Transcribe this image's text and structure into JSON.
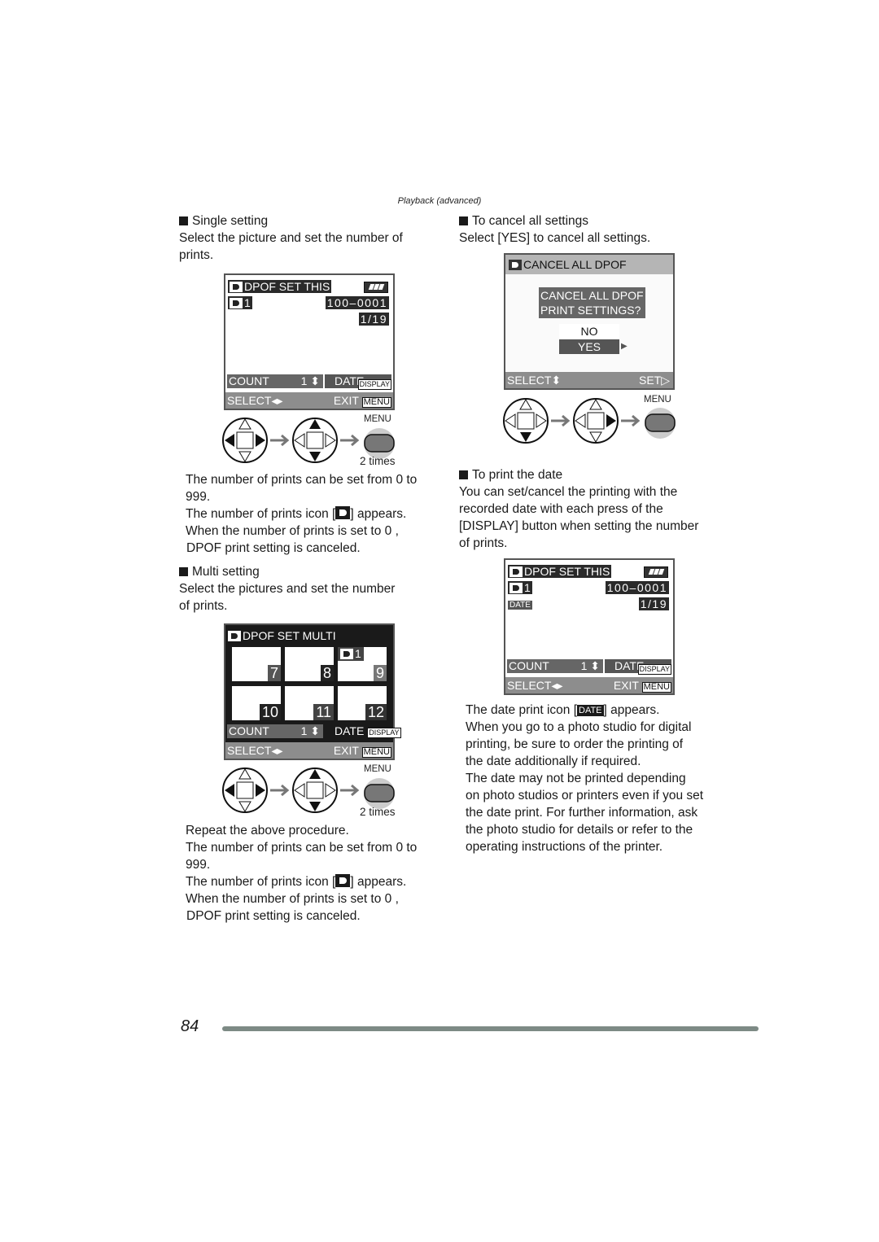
{
  "header": {
    "section": "Playback (advanced)"
  },
  "left": {
    "single": {
      "heading": "Single setting",
      "desc_lines": [
        "Select the picture and set the number of",
        "prints."
      ],
      "screen": {
        "title": "DPOF SET THIS",
        "print_count": "1",
        "file_number": "100–0001",
        "frame": "1/19",
        "count_label": "COUNT",
        "count_value": "1",
        "date_label": "DATE",
        "display_label": "DISPLAY",
        "select_label": "SELECT",
        "exit_label": "EXIT",
        "menu_label": "MENU"
      },
      "steps": {
        "menu_label": "MENU",
        "times_label": "2 times"
      },
      "notes": [
        "The number of prints can be set from 0 to",
        "999.",
        "The number of prints icon [",
        "] appears.",
        "When the number of prints is set to  0 ,",
        "DPOF print setting is canceled."
      ]
    },
    "multi": {
      "heading": "Multi setting",
      "desc_lines": [
        "Select the pictures and set the number",
        "of prints."
      ],
      "screen": {
        "title": "DPOF SET MULTI",
        "thumbs": [
          "7",
          "8",
          "9",
          "10",
          "11",
          "12"
        ],
        "marked_thumb_count": "1",
        "count_label": "COUNT",
        "count_value": "1",
        "date_label": "DATE",
        "display_label": "DISPLAY",
        "select_label": "SELECT",
        "exit_label": "EXIT",
        "menu_label": "MENU"
      },
      "steps": {
        "menu_label": "MENU",
        "times_label": "2 times"
      },
      "notes": [
        "Repeat the above procedure.",
        "The number of prints can be set from 0 to",
        "999.",
        "The number of prints icon [",
        "] appears.",
        "When the number of prints is set to  0 ,",
        "DPOF print setting is canceled."
      ]
    }
  },
  "right": {
    "cancel": {
      "heading": "To cancel all settings",
      "desc": "Select [YES] to cancel all settings.",
      "screen": {
        "title": "CANCEL ALL DPOF",
        "question_line1": "CANCEL ALL DPOF",
        "question_line2": "PRINT SETTINGS?",
        "option_no": "NO",
        "option_yes": "YES",
        "select_label": "SELECT",
        "set_label": "SET"
      },
      "steps": {
        "menu_label": "MENU"
      }
    },
    "date": {
      "heading": "To print the date",
      "desc_lines": [
        "You can set/cancel the printing with the",
        "recorded date with each press of the",
        "[DISPLAY] button when setting the number",
        "of prints."
      ],
      "screen": {
        "title": "DPOF SET THIS",
        "print_count": "1",
        "date_badge": "DATE",
        "file_number": "100–0001",
        "frame": "1/19",
        "count_label": "COUNT",
        "count_value": "1",
        "date_label": "DATE",
        "display_label": "DISPLAY",
        "select_label": "SELECT",
        "exit_label": "EXIT",
        "menu_label": "MENU"
      },
      "notes": [
        "The date print icon [",
        "DATE",
        "] appears.",
        "When you go to a photo studio for digital",
        "printing, be sure to order the printing of",
        "the date additionally if required.",
        "The date may not be printed depending",
        "on photo studios or printers even if you set",
        "the date print. For further information, ask",
        "the photo studio for details or refer to the",
        "operating instructions of the printer."
      ]
    }
  },
  "footer": {
    "page_number": "84"
  },
  "colors": {
    "footer_bar": "#7d8a85",
    "lcd_bar": "#8d8d8d",
    "lcd_dark": "#2a2a2a"
  }
}
